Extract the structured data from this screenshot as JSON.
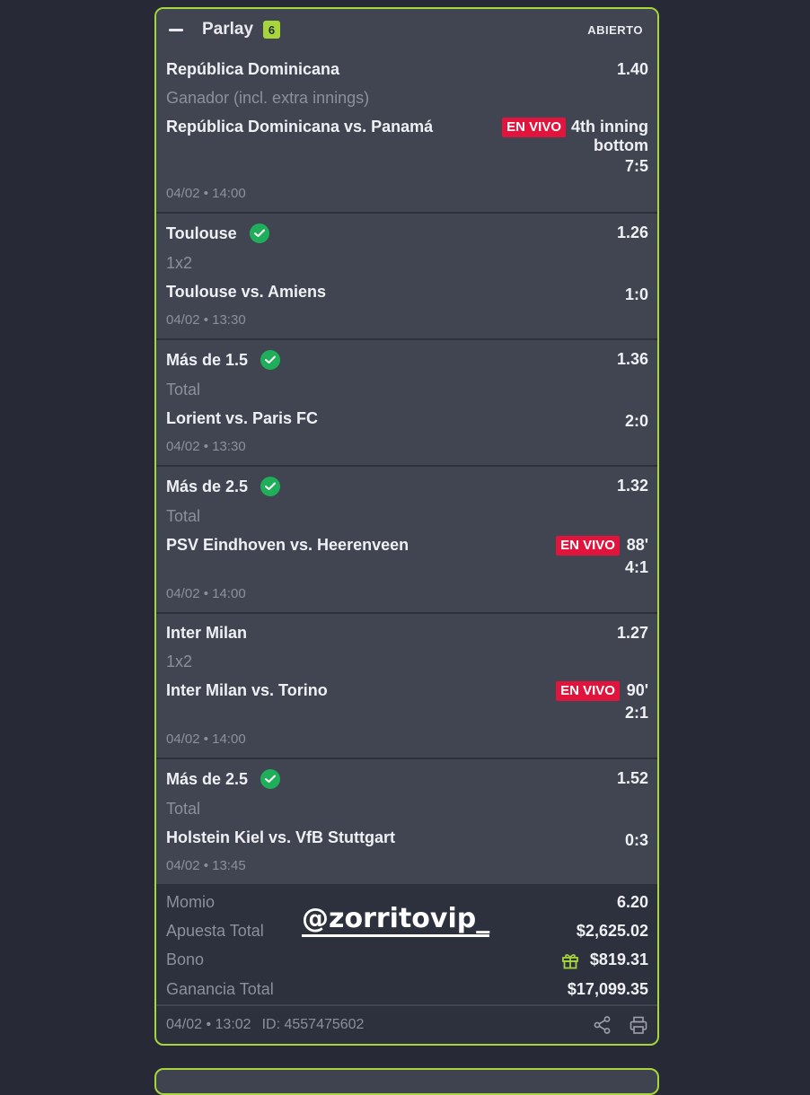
{
  "ticket": {
    "title": "Parlay",
    "count": "6",
    "status": "ABIERTO",
    "legs": [
      {
        "selection": "República Dominicana",
        "odds": "1.40",
        "market": "Ganador (incl. extra innings)",
        "match": "República Dominicana vs. Panamá",
        "live_label": "EN VIVO",
        "clock_line1": "4th inning",
        "clock_line2": "bottom",
        "score": "7:5",
        "date": "04/02 • 14:00"
      },
      {
        "selection": "Toulouse",
        "odds": "1.26",
        "market": "1x2",
        "match": "Toulouse vs. Amiens",
        "score": "1:0",
        "date": "04/02 • 13:30"
      },
      {
        "selection": "Más de 1.5",
        "odds": "1.36",
        "market": "Total",
        "match": "Lorient vs. Paris FC",
        "score": "2:0",
        "date": "04/02 • 13:30"
      },
      {
        "selection": "Más de 2.5",
        "odds": "1.32",
        "market": "Total",
        "match": "PSV Eindhoven vs. Heerenveen",
        "live_label": "EN VIVO",
        "clock": "88'",
        "score": "4:1",
        "date": "04/02 • 14:00"
      },
      {
        "selection": "Inter Milan",
        "odds": "1.27",
        "market": "1x2",
        "match": "Inter Milan vs. Torino",
        "live_label": "EN VIVO",
        "clock": "90'",
        "score": "2:1",
        "date": "04/02 • 14:00"
      },
      {
        "selection": "Más de 2.5",
        "odds": "1.52",
        "market": "Total",
        "match": "Holstein Kiel vs. VfB Stuttgart",
        "score": "0:3",
        "date": "04/02 • 13:45"
      }
    ],
    "summary": {
      "momio_label": "Momio",
      "momio_value": "6.20",
      "stake_label": "Apuesta Total",
      "stake_value": "$2,625.02",
      "bonus_label": "Bono",
      "bonus_value": "$819.31",
      "win_label": "Ganancia Total",
      "win_value": "$17,099.35"
    },
    "footer": {
      "placed": "04/02 • 13:02",
      "bet_id": "ID: 4557475602"
    },
    "watermark": "@zorritovip_"
  },
  "colors": {
    "accent": "#a6d63b",
    "live": "#e0143c",
    "check": "#1faf5a",
    "background": "#272a36"
  },
  "icons": [
    "minus-icon",
    "check-circle-icon",
    "gift-icon",
    "share-icon",
    "print-icon"
  ]
}
